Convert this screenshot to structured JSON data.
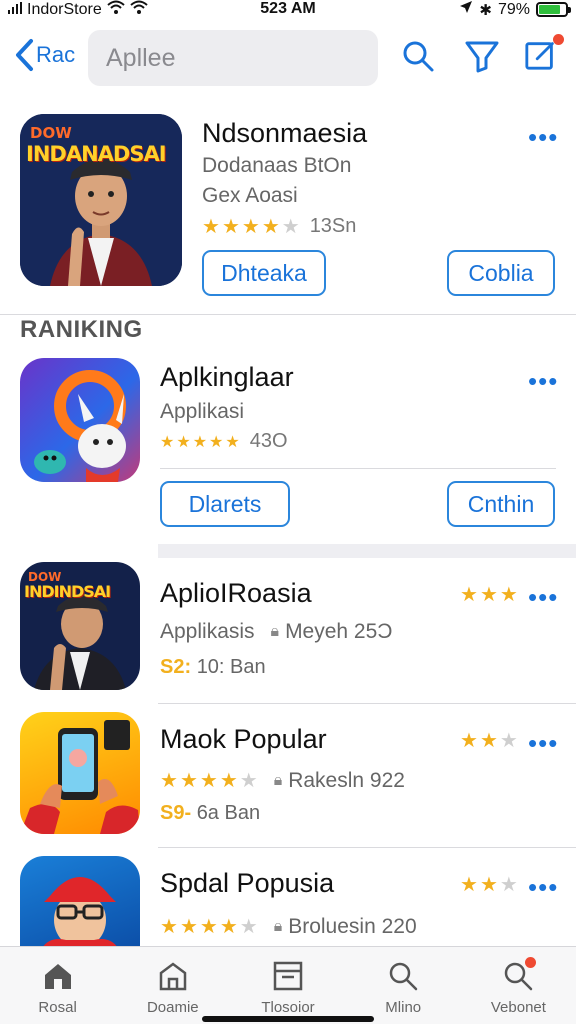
{
  "status_bar": {
    "carrier": "IndorStore",
    "time": "523 AM",
    "battery": "79%",
    "battery_level": 0.79
  },
  "nav": {
    "back_label": "Rac",
    "search_value": "Apllee"
  },
  "featured": {
    "title": "Ndsonmaesia",
    "subtitle1": "Dodanaas BtOn",
    "subtitle2": "Gex Aoasi",
    "rating": 4,
    "rating_count": "13Sn",
    "button_left": "Dhteaka",
    "button_right": "Coblia",
    "icon_text": "INDANADSAI",
    "icon_text_small": "DOW"
  },
  "section": {
    "title": "RANIKING"
  },
  "ranking": [
    {
      "title": "Aplkinglaar",
      "subtitle": "Applikasi",
      "rating": 5,
      "rating_count": "43O",
      "button_left": "Dlarets",
      "button_right": "Cnthin"
    },
    {
      "title": "AplioIRoasia",
      "meta_left": "Applikasis",
      "meta_right": "Meyeh 25Ɔ",
      "price_hl": "S2:",
      "price_text": "10: Ban",
      "corner_rating": 3,
      "icon_text": "INDINDSAI",
      "icon_text_small": "DOW"
    },
    {
      "title": "Maok Popular",
      "rating": 4,
      "meta_right": "Rakesln 922",
      "price_hl": "S9-",
      "price_text": "6a Ban",
      "corner_rating": 2
    },
    {
      "title": "Spdal Popusia",
      "rating": 4,
      "meta_right": "Broluesin 220",
      "corner_rating": 2
    }
  ],
  "tabs": [
    {
      "label": "Rosal",
      "icon": "home-icon"
    },
    {
      "label": "Doamie",
      "icon": "store-icon"
    },
    {
      "label": "Tlosoior",
      "icon": "storage-icon"
    },
    {
      "label": "Mlino",
      "icon": "search-icon"
    },
    {
      "label": "Vebonet",
      "icon": "notifications-search-icon"
    }
  ],
  "colors": {
    "accent": "#1a73d9",
    "star": "#f2b01e",
    "badge": "#ef4a32",
    "battery": "#2fbf3c"
  }
}
